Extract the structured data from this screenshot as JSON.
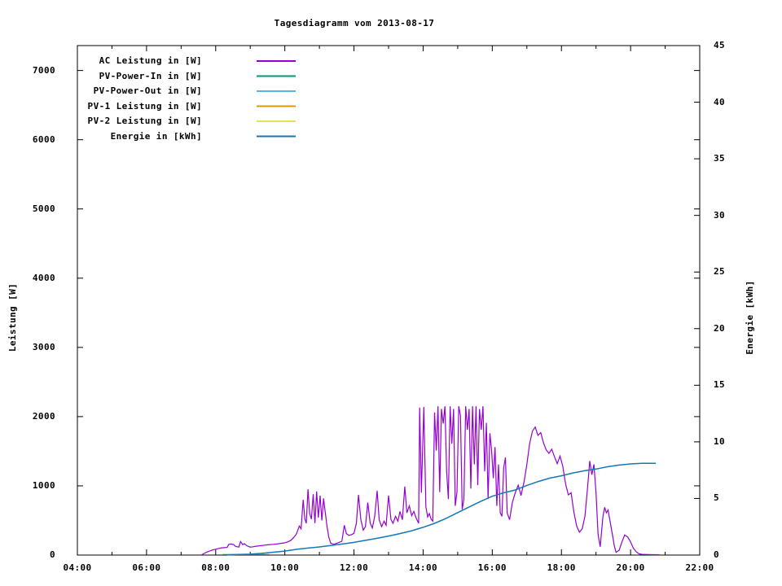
{
  "chart_data": {
    "type": "line",
    "title": "Tagesdiagramm vom 2013-08-17",
    "x_axis": {
      "unit": "time",
      "range_hours": [
        4,
        22
      ],
      "major_tick_step_hours": 2,
      "minor_tick_step_hours": 1,
      "tick_labels": [
        "04:00",
        "06:00",
        "08:00",
        "10:00",
        "12:00",
        "14:00",
        "16:00",
        "18:00",
        "20:00",
        "22:00"
      ]
    },
    "y_left": {
      "label": "Leistung [W]",
      "range": [
        0,
        7360
      ],
      "tick_step": 1000,
      "tick_values": [
        0,
        1000,
        2000,
        3000,
        4000,
        5000,
        6000,
        7000
      ],
      "tick_labels": [
        "0",
        "1000",
        "2000",
        "3000",
        "4000",
        "5000",
        "6000",
        "7000"
      ]
    },
    "y_right": {
      "label": "Energie [kWh]",
      "range": [
        0,
        45
      ],
      "tick_step": 5,
      "tick_values": [
        0,
        5,
        10,
        15,
        20,
        25,
        30,
        35,
        40,
        45
      ],
      "tick_labels": [
        "0",
        "5",
        "10",
        "15",
        "20",
        "25",
        "30",
        "35",
        "40",
        "45"
      ]
    },
    "grid": false,
    "legend_position": "top-left-inside",
    "legend": [
      {
        "label": "AC Leistung in [W]",
        "series_index": 0
      },
      {
        "label": "PV-Power-In in [W]",
        "series_index": 1
      },
      {
        "label": "PV-Power-Out in [W]",
        "series_index": 2
      },
      {
        "label": "PV-1 Leistung in [W]",
        "series_index": 3
      },
      {
        "label": "PV-2 Leistung in [W]",
        "series_index": 4
      },
      {
        "label": "Energie in [kWh]",
        "series_index": 5
      }
    ],
    "series": [
      {
        "name": "ac-leistung",
        "color": "#9400d3",
        "axis": "left",
        "width": 1.2,
        "points": [
          [
            7.58,
            0
          ],
          [
            7.67,
            25
          ],
          [
            7.75,
            45
          ],
          [
            7.83,
            60
          ],
          [
            7.92,
            75
          ],
          [
            8.0,
            85
          ],
          [
            8.08,
            95
          ],
          [
            8.17,
            105
          ],
          [
            8.33,
            110
          ],
          [
            8.38,
            155
          ],
          [
            8.45,
            160
          ],
          [
            8.52,
            150
          ],
          [
            8.58,
            125
          ],
          [
            8.67,
            115
          ],
          [
            8.72,
            195
          ],
          [
            8.78,
            150
          ],
          [
            8.83,
            165
          ],
          [
            8.9,
            135
          ],
          [
            9.0,
            115
          ],
          [
            9.08,
            120
          ],
          [
            9.17,
            128
          ],
          [
            9.33,
            138
          ],
          [
            9.5,
            148
          ],
          [
            9.67,
            155
          ],
          [
            9.83,
            165
          ],
          [
            10.0,
            178
          ],
          [
            10.08,
            190
          ],
          [
            10.17,
            210
          ],
          [
            10.25,
            250
          ],
          [
            10.33,
            300
          ],
          [
            10.42,
            420
          ],
          [
            10.47,
            380
          ],
          [
            10.53,
            800
          ],
          [
            10.58,
            520
          ],
          [
            10.62,
            460
          ],
          [
            10.67,
            950
          ],
          [
            10.72,
            600
          ],
          [
            10.77,
            520
          ],
          [
            10.82,
            880
          ],
          [
            10.87,
            460
          ],
          [
            10.92,
            920
          ],
          [
            10.97,
            540
          ],
          [
            11.02,
            860
          ],
          [
            11.07,
            500
          ],
          [
            11.12,
            820
          ],
          [
            11.17,
            620
          ],
          [
            11.22,
            420
          ],
          [
            11.27,
            260
          ],
          [
            11.33,
            170
          ],
          [
            11.42,
            155
          ],
          [
            11.53,
            175
          ],
          [
            11.65,
            200
          ],
          [
            11.72,
            430
          ],
          [
            11.78,
            310
          ],
          [
            11.85,
            285
          ],
          [
            11.93,
            295
          ],
          [
            12.0,
            315
          ],
          [
            12.07,
            460
          ],
          [
            12.13,
            870
          ],
          [
            12.2,
            510
          ],
          [
            12.27,
            360
          ],
          [
            12.33,
            410
          ],
          [
            12.4,
            760
          ],
          [
            12.47,
            460
          ],
          [
            12.53,
            390
          ],
          [
            12.6,
            560
          ],
          [
            12.67,
            930
          ],
          [
            12.73,
            510
          ],
          [
            12.8,
            410
          ],
          [
            12.87,
            490
          ],
          [
            12.93,
            430
          ],
          [
            13.0,
            860
          ],
          [
            13.07,
            510
          ],
          [
            13.13,
            460
          ],
          [
            13.2,
            560
          ],
          [
            13.27,
            490
          ],
          [
            13.33,
            630
          ],
          [
            13.4,
            510
          ],
          [
            13.47,
            990
          ],
          [
            13.53,
            610
          ],
          [
            13.6,
            710
          ],
          [
            13.67,
            570
          ],
          [
            13.73,
            630
          ],
          [
            13.8,
            530
          ],
          [
            13.87,
            460
          ],
          [
            13.9,
            2130
          ],
          [
            13.95,
            900
          ],
          [
            14.02,
            2140
          ],
          [
            14.08,
            700
          ],
          [
            14.13,
            550
          ],
          [
            14.18,
            600
          ],
          [
            14.23,
            520
          ],
          [
            14.28,
            490
          ],
          [
            14.33,
            2060
          ],
          [
            14.38,
            1510
          ],
          [
            14.43,
            2150
          ],
          [
            14.48,
            910
          ],
          [
            14.53,
            2110
          ],
          [
            14.58,
            1900
          ],
          [
            14.63,
            2150
          ],
          [
            14.68,
            1210
          ],
          [
            14.73,
            810
          ],
          [
            14.78,
            2150
          ],
          [
            14.83,
            1610
          ],
          [
            14.88,
            2110
          ],
          [
            14.93,
            710
          ],
          [
            14.98,
            910
          ],
          [
            15.03,
            2150
          ],
          [
            15.08,
            2010
          ],
          [
            15.13,
            660
          ],
          [
            15.18,
            810
          ],
          [
            15.23,
            2150
          ],
          [
            15.28,
            1810
          ],
          [
            15.33,
            2110
          ],
          [
            15.38,
            960
          ],
          [
            15.43,
            2150
          ],
          [
            15.48,
            1310
          ],
          [
            15.53,
            2150
          ],
          [
            15.58,
            1010
          ],
          [
            15.63,
            2110
          ],
          [
            15.68,
            1810
          ],
          [
            15.73,
            2150
          ],
          [
            15.78,
            1210
          ],
          [
            15.83,
            1910
          ],
          [
            15.88,
            810
          ],
          [
            15.93,
            1760
          ],
          [
            15.98,
            1510
          ],
          [
            16.03,
            1110
          ],
          [
            16.08,
            1560
          ],
          [
            16.13,
            710
          ],
          [
            16.18,
            1310
          ],
          [
            16.23,
            610
          ],
          [
            16.28,
            560
          ],
          [
            16.33,
            1260
          ],
          [
            16.38,
            1410
          ],
          [
            16.43,
            610
          ],
          [
            16.5,
            510
          ],
          [
            16.58,
            760
          ],
          [
            16.67,
            910
          ],
          [
            16.75,
            1010
          ],
          [
            16.83,
            860
          ],
          [
            16.92,
            1060
          ],
          [
            17.0,
            1310
          ],
          [
            17.08,
            1610
          ],
          [
            17.16,
            1790
          ],
          [
            17.24,
            1850
          ],
          [
            17.32,
            1730
          ],
          [
            17.4,
            1770
          ],
          [
            17.48,
            1620
          ],
          [
            17.56,
            1520
          ],
          [
            17.64,
            1470
          ],
          [
            17.72,
            1530
          ],
          [
            17.8,
            1420
          ],
          [
            17.88,
            1320
          ],
          [
            17.96,
            1430
          ],
          [
            18.04,
            1280
          ],
          [
            18.12,
            1030
          ],
          [
            18.2,
            870
          ],
          [
            18.28,
            900
          ],
          [
            18.36,
            620
          ],
          [
            18.44,
            420
          ],
          [
            18.52,
            330
          ],
          [
            18.6,
            380
          ],
          [
            18.68,
            560
          ],
          [
            18.76,
            1000
          ],
          [
            18.82,
            1360
          ],
          [
            18.88,
            1160
          ],
          [
            18.94,
            1310
          ],
          [
            19.0,
            900
          ],
          [
            19.06,
            300
          ],
          [
            19.12,
            120
          ],
          [
            19.2,
            560
          ],
          [
            19.25,
            690
          ],
          [
            19.3,
            610
          ],
          [
            19.35,
            650
          ],
          [
            19.4,
            510
          ],
          [
            19.47,
            310
          ],
          [
            19.53,
            130
          ],
          [
            19.58,
            40
          ],
          [
            19.67,
            70
          ],
          [
            19.75,
            190
          ],
          [
            19.83,
            290
          ],
          [
            19.92,
            260
          ],
          [
            20.0,
            190
          ],
          [
            20.08,
            100
          ],
          [
            20.17,
            45
          ],
          [
            20.25,
            18
          ],
          [
            20.33,
            10
          ],
          [
            20.5,
            8
          ],
          [
            20.7,
            6
          ],
          [
            20.83,
            5
          ]
        ]
      },
      {
        "name": "pv-power-in",
        "color": "#009977",
        "axis": "left",
        "width": 1.2,
        "points": [
          [
            8.2,
            8
          ],
          [
            9.55,
            8
          ]
        ]
      },
      {
        "name": "pv-power-out",
        "color": "#56b4e9",
        "axis": "left",
        "width": 1.2,
        "points": []
      },
      {
        "name": "pv1-leistung",
        "color": "#dd9900",
        "axis": "left",
        "width": 1.2,
        "points": []
      },
      {
        "name": "pv2-leistung",
        "color": "#e8e14a",
        "axis": "left",
        "width": 1.2,
        "points": []
      },
      {
        "name": "energie",
        "color": "#1777b5",
        "axis": "right",
        "width": 1.5,
        "points": [
          [
            8.33,
            0.02
          ],
          [
            8.67,
            0.05
          ],
          [
            9.0,
            0.08
          ],
          [
            9.33,
            0.15
          ],
          [
            9.67,
            0.25
          ],
          [
            10.0,
            0.35
          ],
          [
            10.33,
            0.5
          ],
          [
            10.67,
            0.62
          ],
          [
            11.0,
            0.72
          ],
          [
            11.33,
            0.85
          ],
          [
            11.67,
            0.98
          ],
          [
            12.0,
            1.12
          ],
          [
            12.33,
            1.3
          ],
          [
            12.67,
            1.48
          ],
          [
            13.0,
            1.68
          ],
          [
            13.33,
            1.9
          ],
          [
            13.67,
            2.15
          ],
          [
            14.0,
            2.45
          ],
          [
            14.33,
            2.8
          ],
          [
            14.67,
            3.25
          ],
          [
            15.0,
            3.75
          ],
          [
            15.33,
            4.25
          ],
          [
            15.67,
            4.75
          ],
          [
            16.0,
            5.2
          ],
          [
            16.33,
            5.5
          ],
          [
            16.67,
            5.75
          ],
          [
            17.0,
            6.15
          ],
          [
            17.33,
            6.5
          ],
          [
            17.67,
            6.8
          ],
          [
            18.0,
            7.0
          ],
          [
            18.33,
            7.25
          ],
          [
            18.67,
            7.45
          ],
          [
            19.0,
            7.6
          ],
          [
            19.33,
            7.8
          ],
          [
            19.67,
            7.95
          ],
          [
            20.0,
            8.05
          ],
          [
            20.33,
            8.1
          ],
          [
            20.73,
            8.1
          ]
        ]
      }
    ],
    "colors": {
      "border": "#000000",
      "background": "#ffffff",
      "ac": "#9400d3",
      "pv_in": "#009977",
      "pv_out": "#56b4e9",
      "pv1": "#dd9900",
      "pv2": "#e8e14a",
      "energie": "#1777b5"
    }
  }
}
